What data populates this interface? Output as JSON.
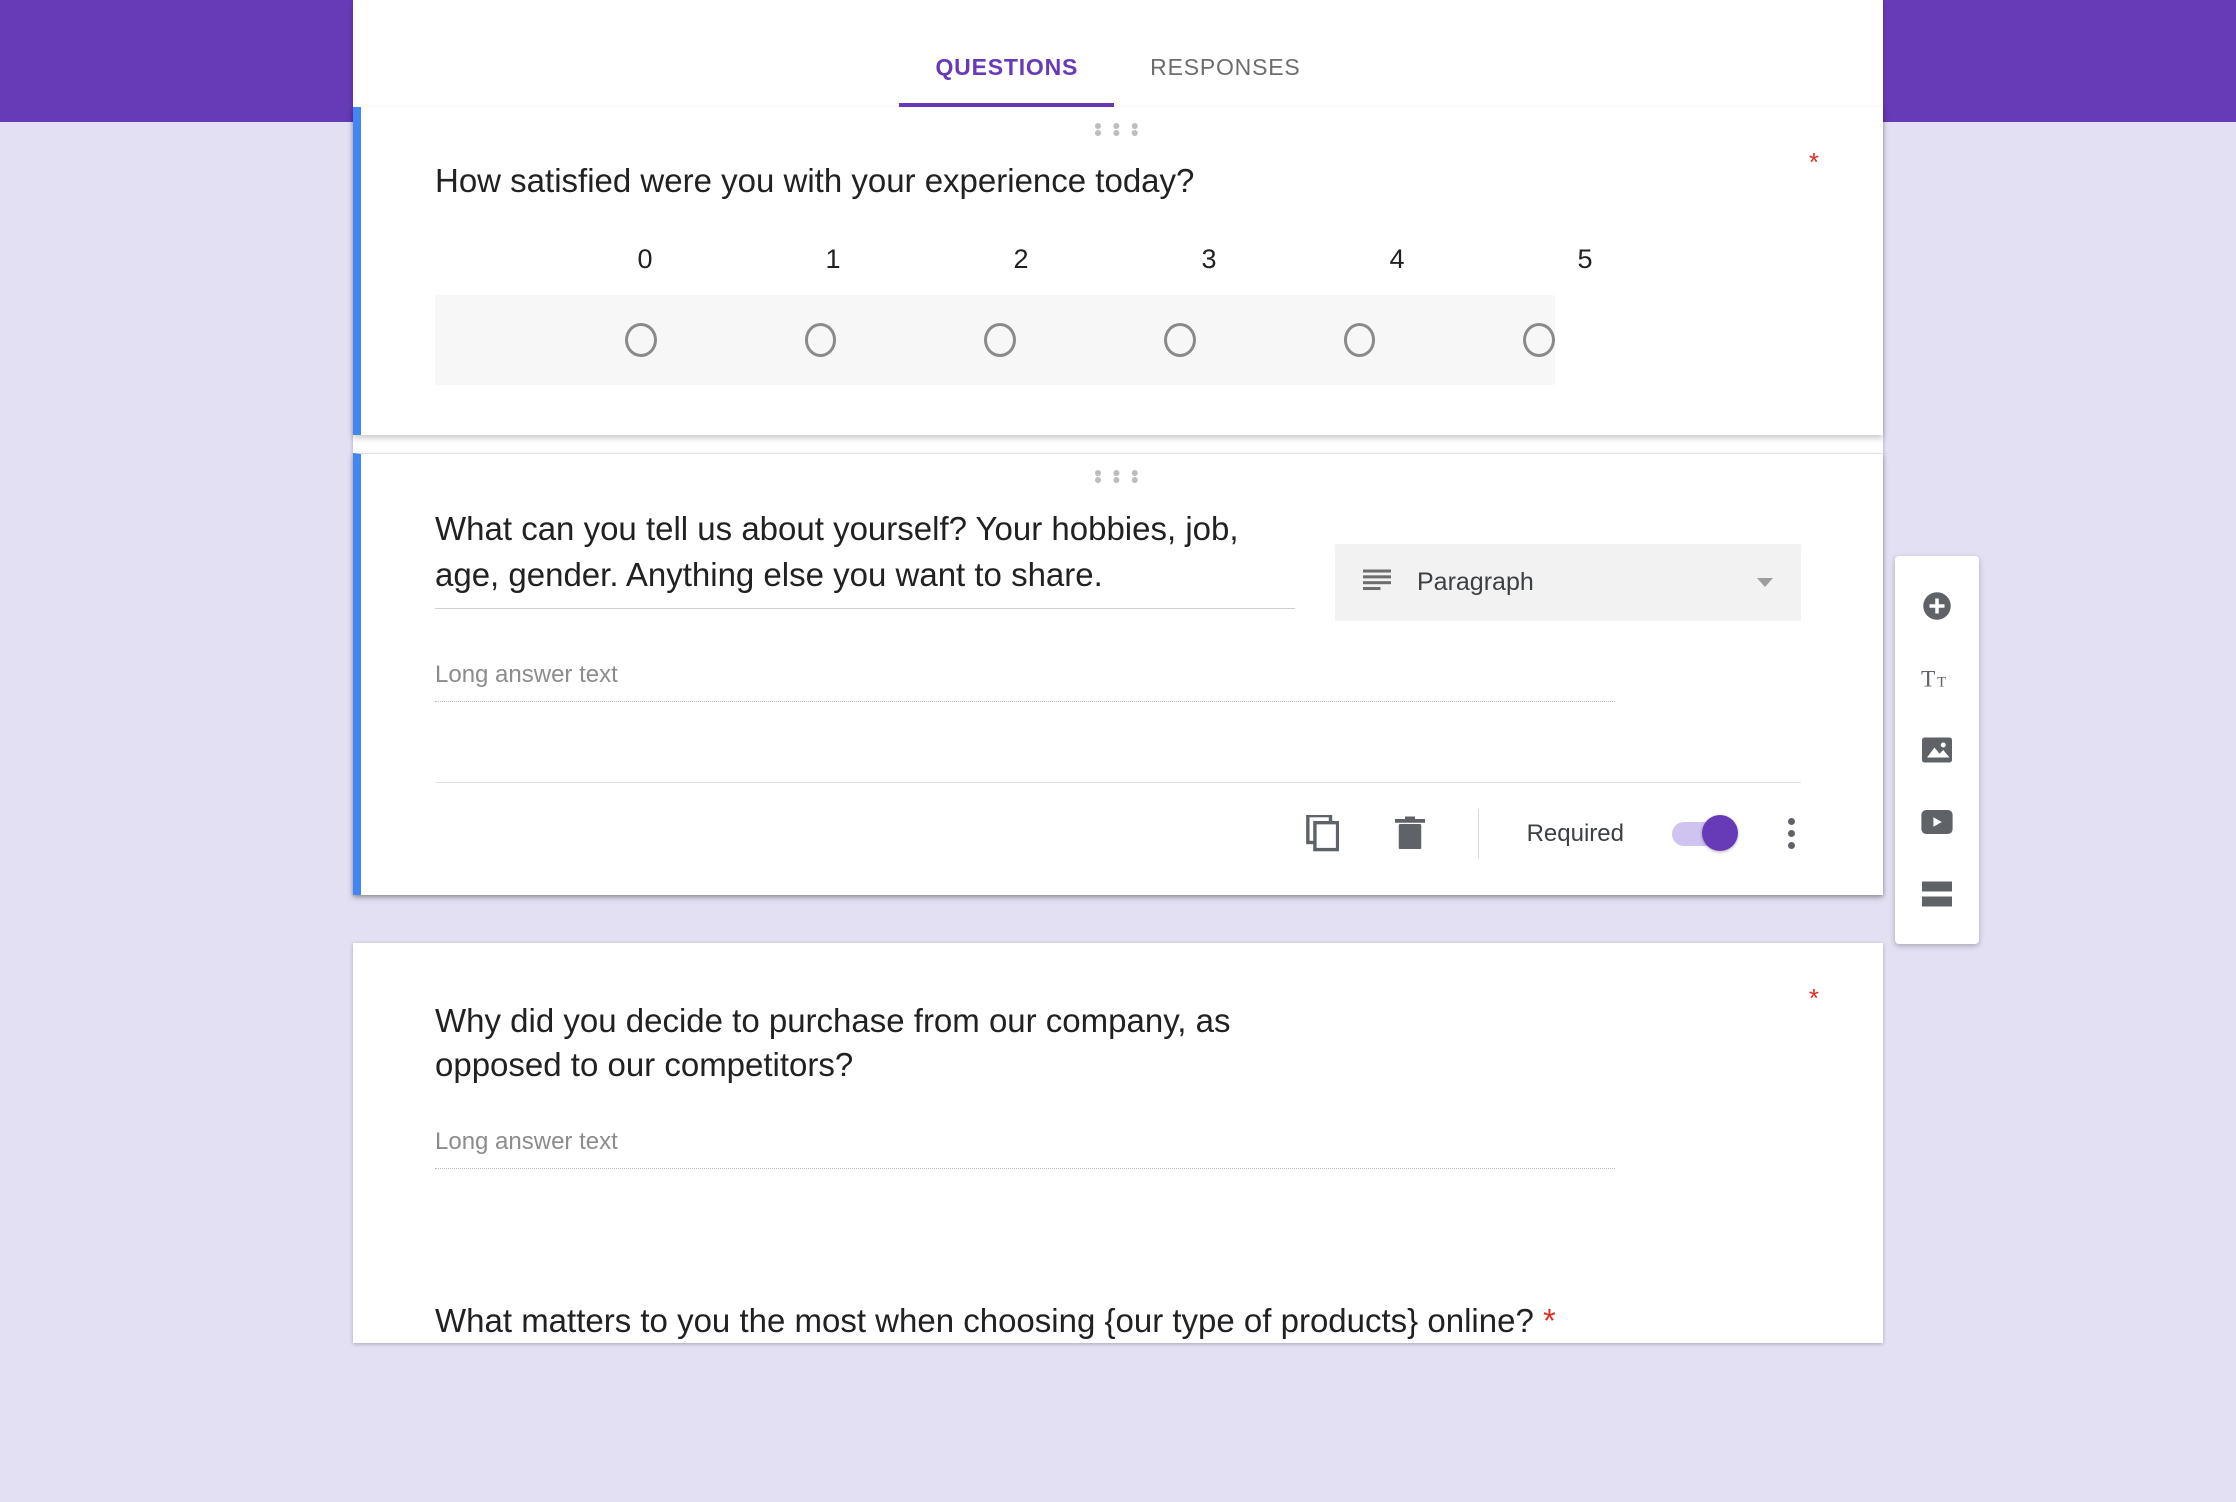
{
  "tabs": {
    "questions": "QUESTIONS",
    "responses": "RESPONSES"
  },
  "questions": {
    "q1": {
      "title": "How satisfied were you with your experience today?",
      "required": true,
      "scale": {
        "labels": [
          "0",
          "1",
          "2",
          "3",
          "4",
          "5"
        ]
      }
    },
    "q2": {
      "title": "What can you tell us about yourself? Your hobbies, job, age, gender. Anything else you want to share.",
      "typeLabel": "Paragraph",
      "placeholder": "Long answer text",
      "requiredLabel": "Required",
      "requiredOn": true
    },
    "q3": {
      "title": "Why did you decide to purchase from our company, as opposed to our competitors?",
      "placeholder": "Long answer text",
      "required": true
    },
    "q4": {
      "title": "What matters to you the most when choosing {our type of products} online?",
      "required": true
    }
  },
  "sideToolbar": {
    "add": "add-question",
    "title": "add-title",
    "image": "add-image",
    "video": "add-video",
    "section": "add-section"
  }
}
